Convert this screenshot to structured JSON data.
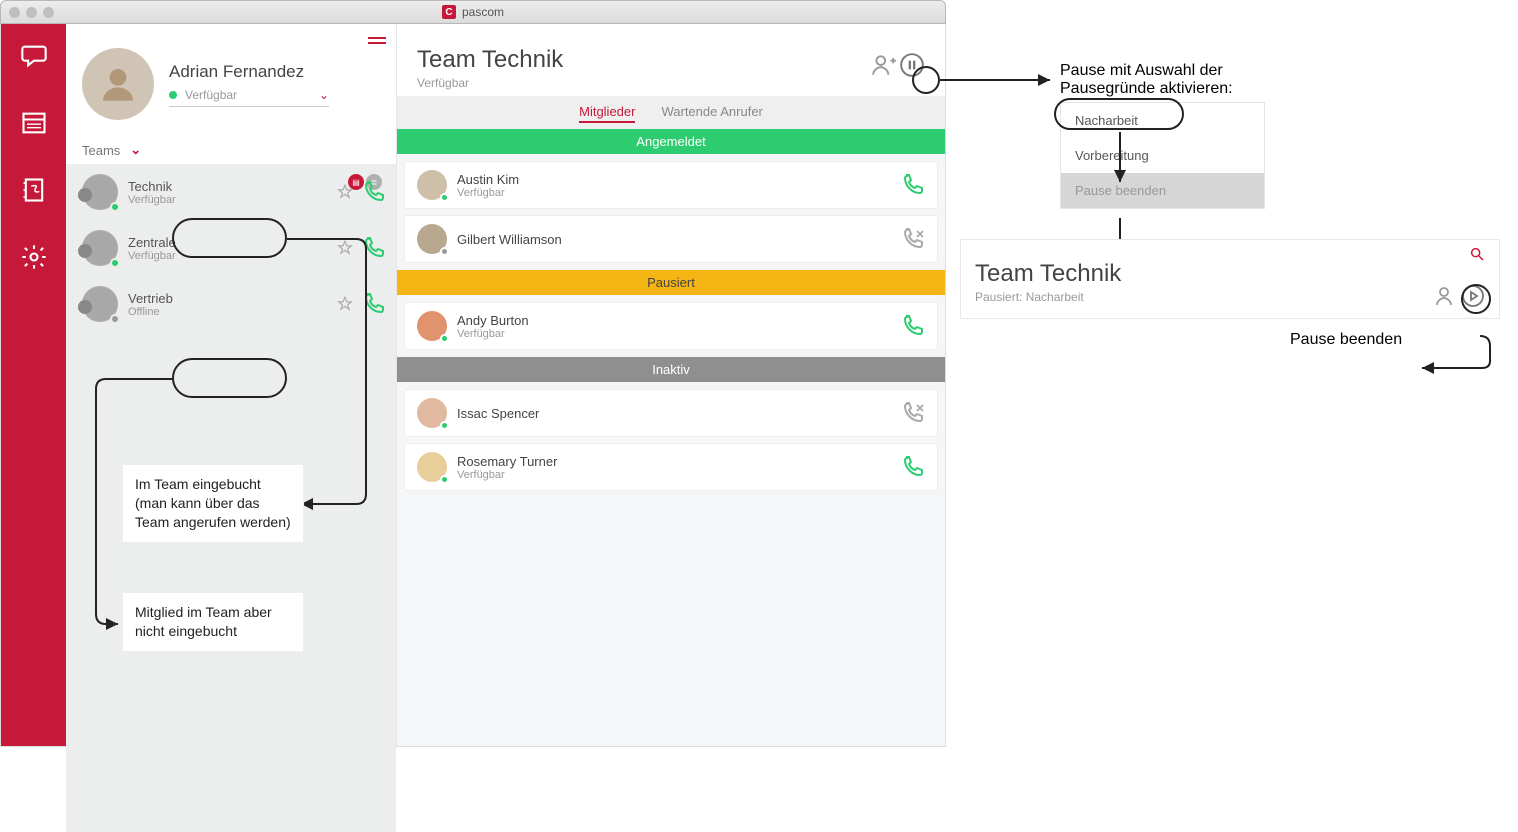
{
  "window": {
    "title": "pascom"
  },
  "profile": {
    "name": "Adrian Fernandez",
    "status": "Verfügbar"
  },
  "sidebar": {
    "sections_label": "Teams"
  },
  "teams": [
    {
      "name": "Technik",
      "status": "Verfügbar",
      "online": true
    },
    {
      "name": "Zentrale",
      "status": "Verfügbar",
      "online": true
    },
    {
      "name": "Vertrieb",
      "status": "Offline",
      "online": false
    }
  ],
  "main": {
    "team_name": "Team Technik",
    "team_status": "Verfügbar",
    "tabs": {
      "members": "Mitglieder",
      "waiting": "Wartende Anrufer"
    },
    "sections": {
      "loggedin": "Angemeldet",
      "paused": "Pausiert",
      "inactive": "Inaktiv"
    },
    "members": {
      "loggedin": [
        {
          "name": "Austin Kim",
          "status": "Verfügbar",
          "online": true,
          "call": "ok"
        },
        {
          "name": "Gilbert Williamson",
          "status": "",
          "online": false,
          "call": "miss"
        }
      ],
      "paused": [
        {
          "name": "Andy Burton",
          "status": "Verfügbar",
          "online": true,
          "call": "ok"
        }
      ],
      "inactive": [
        {
          "name": "Issac Spencer",
          "status": "",
          "online": true,
          "call": "miss"
        },
        {
          "name": "Rosemary Turner",
          "status": "Verfügbar",
          "online": true,
          "call": "ok"
        }
      ]
    }
  },
  "annotations": {
    "booked": "Im Team eingebucht (man kann über das Team angerufen werden)",
    "not_booked": "Mitglied im Team aber nicht eingebucht",
    "pause_heading": "Pause mit Auswahl der Pausegründe aktivieren:",
    "pause_end_label": "Pause beenden"
  },
  "pause_menu": {
    "items": [
      "Nacharbeit",
      "Vorbereitung",
      "Pause beenden"
    ]
  },
  "paused_panel": {
    "team_name": "Team Technik",
    "status": "Pausiert: Nacharbeit"
  }
}
